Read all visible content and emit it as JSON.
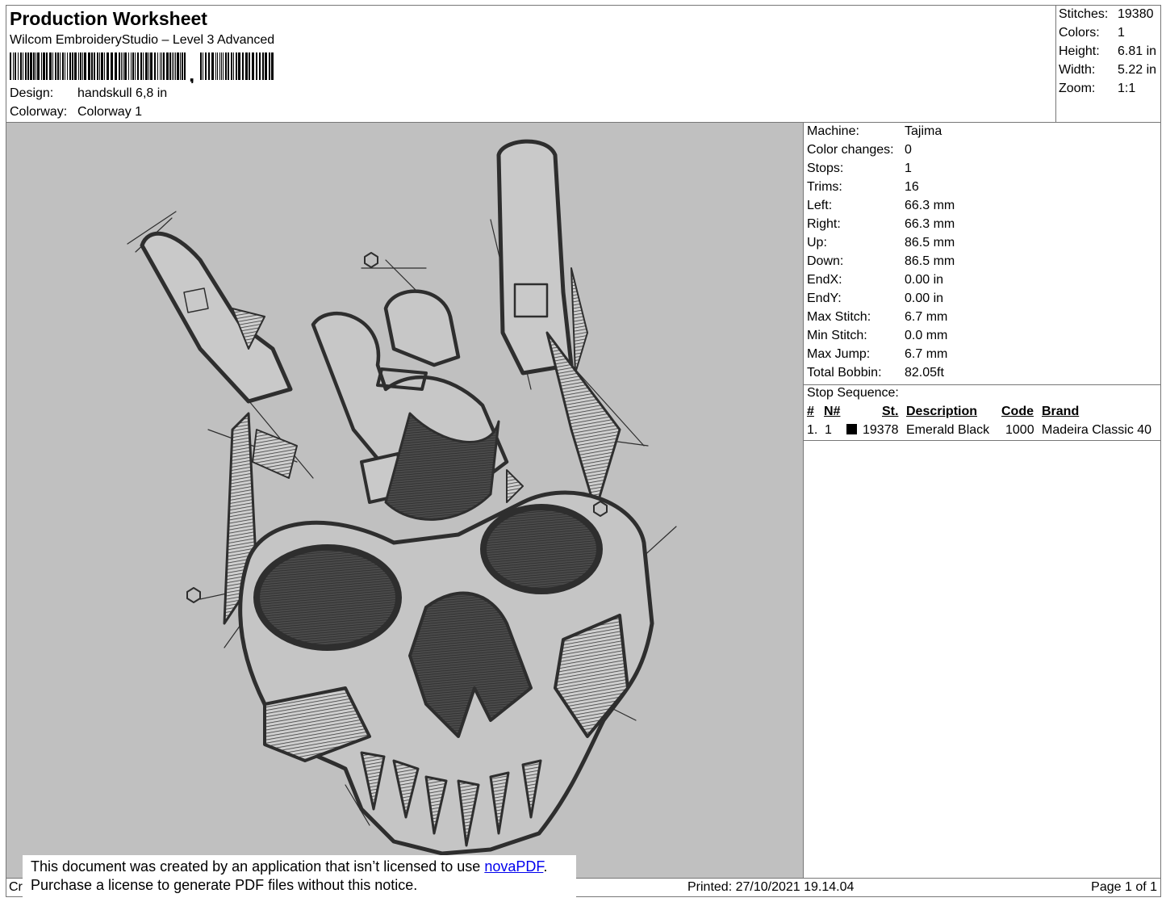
{
  "header": {
    "title": "Production Worksheet",
    "software": "Wilcom EmbroideryStudio – Level 3 Advanced",
    "barcode_separator": ",",
    "design_label": "Design:",
    "design_value": "handskull 6,8 in",
    "colorway_label": "Colorway:",
    "colorway_value": "Colorway 1"
  },
  "stats": [
    {
      "label": "Stitches:",
      "value": "19380"
    },
    {
      "label": "Colors:",
      "value": "1"
    },
    {
      "label": "Height:",
      "value": "6.81 in"
    },
    {
      "label": "Width:",
      "value": "5.22 in"
    },
    {
      "label": "Zoom:",
      "value": "1:1"
    }
  ],
  "machine_info": [
    {
      "label": "Machine:",
      "value": "Tajima"
    },
    {
      "label": "Color changes:",
      "value": "0"
    },
    {
      "label": "Stops:",
      "value": "1"
    },
    {
      "label": "Trims:",
      "value": "16"
    },
    {
      "label": "Left:",
      "value": "66.3 mm"
    },
    {
      "label": "Right:",
      "value": "66.3 mm"
    },
    {
      "label": "Up:",
      "value": "86.5 mm"
    },
    {
      "label": "Down:",
      "value": "86.5 mm"
    },
    {
      "label": "EndX:",
      "value": "0.00 in"
    },
    {
      "label": "EndY:",
      "value": "0.00 in"
    },
    {
      "label": "Max Stitch:",
      "value": "6.7 mm"
    },
    {
      "label": "Min Stitch:",
      "value": "0.0 mm"
    },
    {
      "label": "Max Jump:",
      "value": "6.7 mm"
    },
    {
      "label": "Total Bobbin:",
      "value": "82.05ft"
    }
  ],
  "stop_sequence": {
    "title": "Stop Sequence:",
    "columns": [
      "#",
      "N#",
      "St.",
      "Description",
      "Code",
      "Brand"
    ],
    "rows": [
      {
        "num": "1.",
        "n": "1",
        "swatch_color": "#000000",
        "stitches": "19378",
        "description": "Emerald Black",
        "code": "1000",
        "brand": "Madeira Classic 40"
      }
    ]
  },
  "footer": {
    "created_prefix": "Cr",
    "printed": "Printed: 27/10/2021 19.14.04",
    "page": "Page 1 of 1"
  },
  "notice": {
    "line1_prefix": "This document was created by an application that isn’t licensed to use ",
    "link_text": "novaPDF",
    "line1_suffix": ".",
    "line2": "Purchase a license to generate PDF files without this notice."
  },
  "colors": {
    "design_background": "#c0c0c0",
    "thread": "#2e2e2e",
    "link": "#0000ee"
  }
}
